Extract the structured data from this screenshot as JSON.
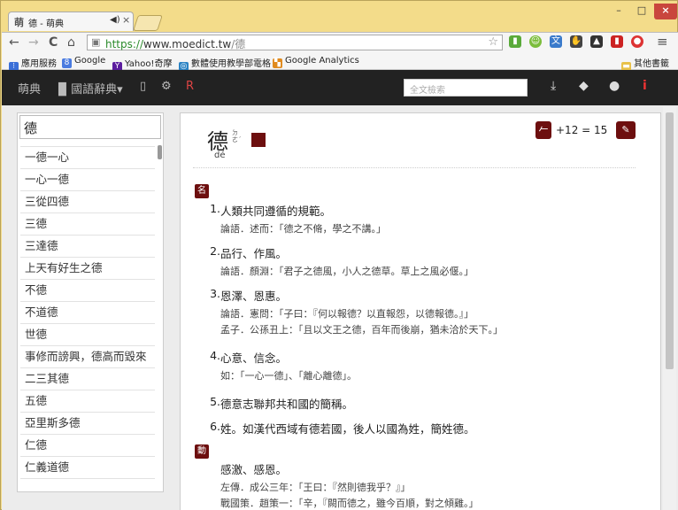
{
  "browser": {
    "tab_icon": "萌",
    "tab_title": "德 - 萌典",
    "tab_audio_icon": "speaker-icon",
    "tab_close": "×",
    "win_min": "–",
    "win_max": "□",
    "win_close": "×",
    "url_scheme": "https://",
    "url_host": "www.moedict.tw",
    "url_path": "/德",
    "back_icon": "←",
    "forward_icon": "→",
    "reload_icon": "C",
    "home_icon": "⌂",
    "lock_icon": "🔒",
    "star_icon": "☆",
    "menu_icon": "≡",
    "bookmarks": [
      {
        "label": "應用服務",
        "icon": "apps-icon",
        "glyph": "⁝⁝",
        "color": "#3a6fd8"
      },
      {
        "label": "Google",
        "icon": "google-icon",
        "glyph": "8",
        "color": "#4a7be0"
      },
      {
        "label": "Yahoo!奇摩",
        "icon": "yahoo-icon",
        "glyph": "Y",
        "color": "#5b1c9e"
      },
      {
        "label": "數體使用教學部電格",
        "icon": "globe-icon",
        "glyph": "◎",
        "color": "#2b83c4"
      },
      {
        "label": "Google Analytics",
        "icon": "analytics-icon",
        "glyph": "▚",
        "color": "#e08a1e"
      }
    ],
    "other_bookmarks": "其他書籤"
  },
  "navbar": {
    "brand": "萌典",
    "dict_menu": "國語辭典",
    "search_placeholder": "全文檢索"
  },
  "sidebar": {
    "query": "德",
    "items": [
      "一德一心",
      "一心一德",
      "三從四德",
      "三德",
      "三達德",
      "上天有好生之德",
      "不德",
      "不道德",
      "世德",
      "事修而謗興，德高而毀來",
      "二三其德",
      "五德",
      "亞里斯多德",
      "仁德",
      "仁義道德"
    ]
  },
  "entry": {
    "word": "德",
    "bopomofo": "ㄉㄜˊ",
    "pinyin": "dé",
    "stroke_label": "𠂉",
    "radical_info": "+12 = 15",
    "edit_icon": "✎",
    "pos_noun": "名",
    "pos_verb": "動",
    "definitions": [
      {
        "num": "1.",
        "text": "人類共同遵循的規範。",
        "examples": [
          "論語．述而：「德之不脩，學之不講。」"
        ]
      },
      {
        "num": "2.",
        "text": "品行、作風。",
        "examples": [
          "論語．顏淵：「君子之德風，小人之德草。草上之風必偃。」"
        ]
      },
      {
        "num": "3.",
        "text": "恩澤、恩惠。",
        "examples": [
          "論語．憲問：「子曰：『何以報德？以直報怨，以德報德。』」",
          "孟子．公孫丑上：「且以文王之德，百年而後崩，猶未洽於天下。」"
        ]
      },
      {
        "num": "4.",
        "text": "心意、信念。",
        "examples": [
          "如：「一心一德」、「離心離德」。"
        ]
      },
      {
        "num": "5.",
        "text": "德意志聯邦共和國的簡稱。",
        "examples": []
      },
      {
        "num": "6.",
        "text": "姓。如漢代西域有德若國，後人以國為姓，簡姓德。",
        "examples": []
      }
    ],
    "verb_def": {
      "text": "感激、感恩。",
      "examples": [
        "左傳．成公三年：「王曰：『然則德我乎？』」",
        "戰國策．趙策一：「辛，『闕而德之，雖今百順，對之傾雞。」"
      ]
    }
  }
}
